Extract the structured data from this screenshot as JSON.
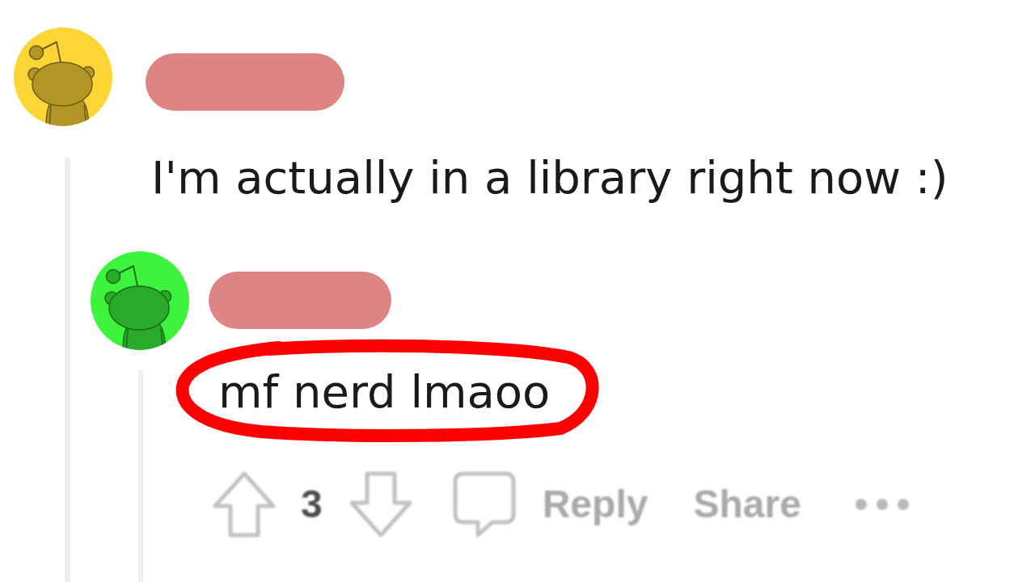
{
  "comments": [
    {
      "avatar": {
        "color": "#fdd535"
      },
      "username_redacted": true,
      "body": "I'm actually in a library right now :)",
      "replies": [
        {
          "avatar": {
            "color": "#3bf43b"
          },
          "username_redacted": true,
          "body": "mf nerd lmaoo",
          "circled": true,
          "actions": {
            "score": "3",
            "reply": "Reply",
            "share": "Share"
          }
        }
      ]
    }
  ]
}
